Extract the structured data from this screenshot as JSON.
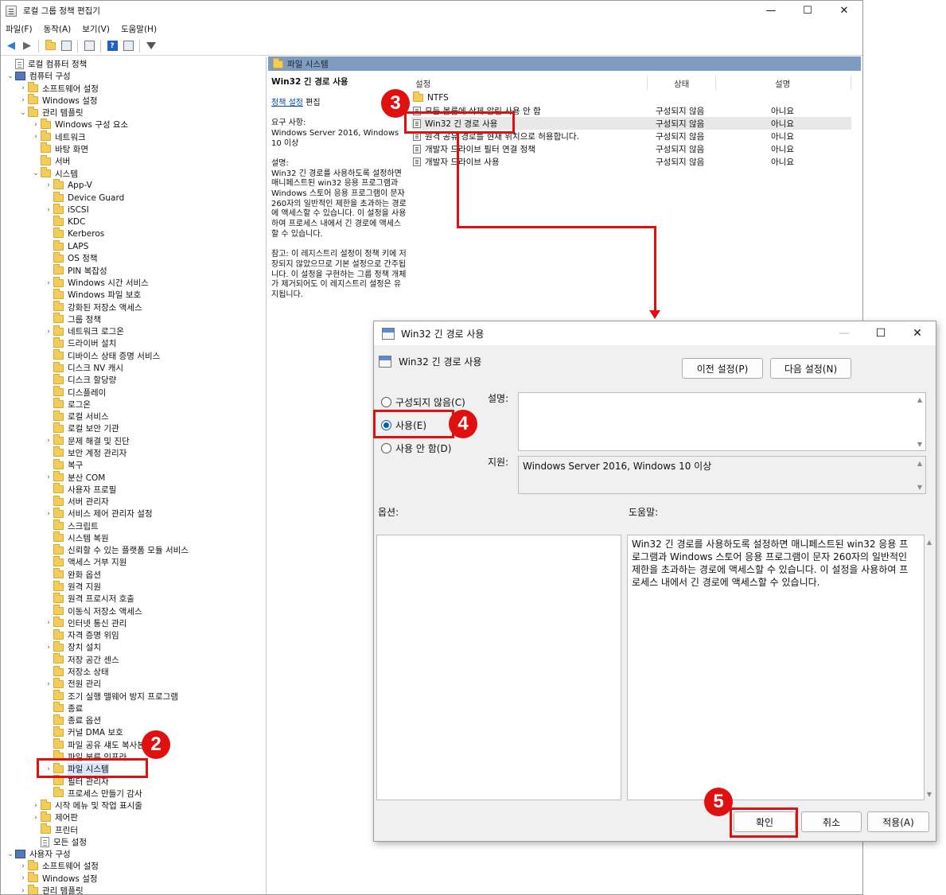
{
  "window": {
    "title": "로컬 그룹 정책 편집기",
    "minimize": "—",
    "maximize": "☐",
    "close": "✕"
  },
  "menu": [
    "파일(F)",
    "동작(A)",
    "보기(V)",
    "도움말(H)"
  ],
  "tree": {
    "root": "로컬 컴퓨터 정책",
    "computer_config": "컴퓨터 구성",
    "items": [
      {
        "label": "소프트웨어 설정",
        "level": 2,
        "expander": ">"
      },
      {
        "label": "Windows 설정",
        "level": 2,
        "expander": ">"
      },
      {
        "label": "관리 템플릿",
        "level": 2,
        "expander": "v"
      },
      {
        "label": "Windows 구성 요소",
        "level": 3,
        "expander": ">"
      },
      {
        "label": "네트워크",
        "level": 3,
        "expander": ">"
      },
      {
        "label": "바탕 화면",
        "level": 3,
        "expander": ""
      },
      {
        "label": "서버",
        "level": 3,
        "expander": ""
      },
      {
        "label": "시스템",
        "level": 3,
        "expander": "v"
      },
      {
        "label": "App-V",
        "level": 4,
        "expander": ">"
      },
      {
        "label": "Device Guard",
        "level": 4,
        "expander": ""
      },
      {
        "label": "iSCSI",
        "level": 4,
        "expander": ">"
      },
      {
        "label": "KDC",
        "level": 4,
        "expander": ""
      },
      {
        "label": "Kerberos",
        "level": 4,
        "expander": ""
      },
      {
        "label": "LAPS",
        "level": 4,
        "expander": ""
      },
      {
        "label": "OS 정책",
        "level": 4,
        "expander": ""
      },
      {
        "label": "PIN 복잡성",
        "level": 4,
        "expander": ""
      },
      {
        "label": "Windows 시간 서비스",
        "level": 4,
        "expander": ">"
      },
      {
        "label": "Windows 파일 보호",
        "level": 4,
        "expander": ""
      },
      {
        "label": "강화된 저장소 액세스",
        "level": 4,
        "expander": ""
      },
      {
        "label": "그룹 정책",
        "level": 4,
        "expander": ""
      },
      {
        "label": "네트워크 로그온",
        "level": 4,
        "expander": ">"
      },
      {
        "label": "드라이버 설치",
        "level": 4,
        "expander": ""
      },
      {
        "label": "디바이스 상태 증명 서비스",
        "level": 4,
        "expander": ""
      },
      {
        "label": "디스크 NV 캐시",
        "level": 4,
        "expander": ""
      },
      {
        "label": "디스크 할당량",
        "level": 4,
        "expander": ""
      },
      {
        "label": "디스플레이",
        "level": 4,
        "expander": ""
      },
      {
        "label": "로그온",
        "level": 4,
        "expander": ""
      },
      {
        "label": "로컬 서비스",
        "level": 4,
        "expander": ""
      },
      {
        "label": "로컬 보안 기관",
        "level": 4,
        "expander": ""
      },
      {
        "label": "문제 해결 및 진단",
        "level": 4,
        "expander": ">"
      },
      {
        "label": "보안 계정 관리자",
        "level": 4,
        "expander": ""
      },
      {
        "label": "복구",
        "level": 4,
        "expander": ""
      },
      {
        "label": "분산 COM",
        "level": 4,
        "expander": ">"
      },
      {
        "label": "사용자 프로필",
        "level": 4,
        "expander": ""
      },
      {
        "label": "서버 관리자",
        "level": 4,
        "expander": ""
      },
      {
        "label": "서비스 제어 관리자 설정",
        "level": 4,
        "expander": ">"
      },
      {
        "label": "스크립트",
        "level": 4,
        "expander": ""
      },
      {
        "label": "시스템 복원",
        "level": 4,
        "expander": ""
      },
      {
        "label": "신뢰할 수 있는 플랫폼 모듈 서비스",
        "level": 4,
        "expander": ""
      },
      {
        "label": "액세스 거부 지원",
        "level": 4,
        "expander": ""
      },
      {
        "label": "완화 옵션",
        "level": 4,
        "expander": ""
      },
      {
        "label": "원격 지원",
        "level": 4,
        "expander": ""
      },
      {
        "label": "원격 프로시저 호출",
        "level": 4,
        "expander": ""
      },
      {
        "label": "이동식 저장소 액세스",
        "level": 4,
        "expander": ""
      },
      {
        "label": "인터넷 통신 관리",
        "level": 4,
        "expander": ">"
      },
      {
        "label": "자격 증명 위임",
        "level": 4,
        "expander": ""
      },
      {
        "label": "장치 설치",
        "level": 4,
        "expander": ">"
      },
      {
        "label": "저장 공간 센스",
        "level": 4,
        "expander": ""
      },
      {
        "label": "저장소 상태",
        "level": 4,
        "expander": ""
      },
      {
        "label": "전원 관리",
        "level": 4,
        "expander": ">"
      },
      {
        "label": "조기 실행 맬웨어 방지 프로그램",
        "level": 4,
        "expander": ""
      },
      {
        "label": "종료",
        "level": 4,
        "expander": ""
      },
      {
        "label": "종료 옵션",
        "level": 4,
        "expander": ""
      },
      {
        "label": "커널 DMA 보호",
        "level": 4,
        "expander": ""
      },
      {
        "label": "파일 공유 섀도 복사본 공급자",
        "level": 4,
        "expander": ""
      },
      {
        "label": "파일 분류 인프라",
        "level": 4,
        "expander": ""
      },
      {
        "label": "파일 시스템",
        "level": 4,
        "expander": ">",
        "selected": true
      },
      {
        "label": "필터 관리자",
        "level": 4,
        "expander": ""
      },
      {
        "label": "프로세스 만들기 감사",
        "level": 4,
        "expander": ""
      },
      {
        "label": "시작 메뉴 및 작업 표시줄",
        "level": 3,
        "expander": ">"
      },
      {
        "label": "제어판",
        "level": 3,
        "expander": ">"
      },
      {
        "label": "프린터",
        "level": 3,
        "expander": ""
      },
      {
        "label": "모든 설정",
        "level": 3,
        "expander": "",
        "icon": "doc"
      }
    ],
    "user_config": "사용자 구성",
    "user_items": [
      {
        "label": "소프트웨어 설정",
        "level": 2,
        "expander": ">"
      },
      {
        "label": "Windows 설정",
        "level": 2,
        "expander": ">"
      },
      {
        "label": "관리 템플릿",
        "level": 2,
        "expander": ">"
      }
    ]
  },
  "content": {
    "header": "파일 시스템",
    "desc_title": "Win32 긴 경로 사용",
    "policy_link": "정책 설정",
    "edit": "편집",
    "requirements_label": "요구 사항:",
    "requirements": "Windows Server 2016, Windows 10 이상",
    "description_label": "설명:",
    "description": "Win32 긴 경로를 사용하도록 설정하면 매니페스트된 win32 응용 프로그램과 Windows 스토어 응용 프로그램이 문자 260자의 일반적인 제한을 초과하는 경로에 액세스할 수 있습니다. 이 설정을 사용하여 프로세스 내에서 긴 경로에 액세스할 수 있습니다.",
    "note": "참고: 이 레지스트리 설정이 정책 키에 저장되지 않았으므로 기본 설정으로 간주됩니다. 이 설정을 구현하는 그룹 정책 개체가 제거되어도 이 레지스트리 설정은 유지됩니다.",
    "columns": [
      "설정",
      "상태",
      "설명"
    ],
    "rows": [
      {
        "name": "NTFS",
        "status": "",
        "comment": "",
        "type": "folder"
      },
      {
        "name": "모든 볼륨에 삭제 알림 사용 안 함",
        "status": "구성되지 않음",
        "comment": "아니요",
        "type": "setting"
      },
      {
        "name": "Win32 긴 경로 사용",
        "status": "구성되지 않음",
        "comment": "아니요",
        "type": "setting",
        "selected": true
      },
      {
        "name": "원격 공유 경로를 현재 위치으로 허용합니다.",
        "status": "구성되지 않음",
        "comment": "아니요",
        "type": "setting"
      },
      {
        "name": "개발자 드라이브 필터 연결 정책",
        "status": "구성되지 않음",
        "comment": "아니요",
        "type": "setting"
      },
      {
        "name": "개발자 드라이브 사용",
        "status": "구성되지 않음",
        "comment": "아니요",
        "type": "setting"
      }
    ]
  },
  "dialog": {
    "title": "Win32 긴 경로 사용",
    "subtitle": "Win32 긴 경로 사용",
    "prev_button": "이전 설정(P)",
    "next_button": "다음 설정(N)",
    "radios": [
      {
        "label": "구성되지 않음(C)",
        "checked": false
      },
      {
        "label": "사용(E)",
        "checked": true
      },
      {
        "label": "사용 안 함(D)",
        "checked": false
      }
    ],
    "comment_label": "설명:",
    "supported_label": "지원:",
    "supported_value": "Windows Server 2016, Windows 10 이상",
    "options_label": "옵션:",
    "help_label": "도움말:",
    "help_text": "Win32 긴 경로를 사용하도록 설정하면 매니페스트된 win32 응용 프로그램과 Windows 스토어 응용 프로그램이 문자 260자의 일반적인 제한을 초과하는 경로에 액세스할 수 있습니다. 이 설정을 사용하여 프로세스 내에서 긴 경로에 액세스할 수 있습니다.",
    "ok_button": "확인",
    "cancel_button": "취소",
    "apply_button": "적용(A)"
  },
  "annotations": {
    "step2": "2",
    "step3": "3",
    "step4": "4",
    "step5": "5",
    "color": "#e01010"
  }
}
